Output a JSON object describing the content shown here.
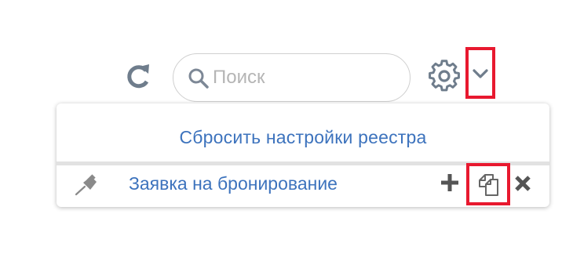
{
  "toolbar": {
    "refresh_icon": "refresh-icon",
    "search": {
      "placeholder": "Поиск",
      "value": "",
      "icon": "search-icon"
    },
    "settings_icon": "gear-icon",
    "dropdown_icon": "chevron-down-icon"
  },
  "menu": {
    "reset_label": "Сбросить настройки реестра",
    "presets": [
      {
        "label": "Заявка на бронирование",
        "pin_icon": "pin-icon",
        "actions": {
          "add_icon": "plus-icon",
          "copy_icon": "copy-icon",
          "delete_icon": "close-icon"
        }
      }
    ]
  },
  "colors": {
    "link_blue": "#3d73bd",
    "icon_gray": "#6f7d8c",
    "highlight_red": "#e8192f",
    "border_gray": "#cfcfcf",
    "divider_gray": "#e2e2e2"
  }
}
